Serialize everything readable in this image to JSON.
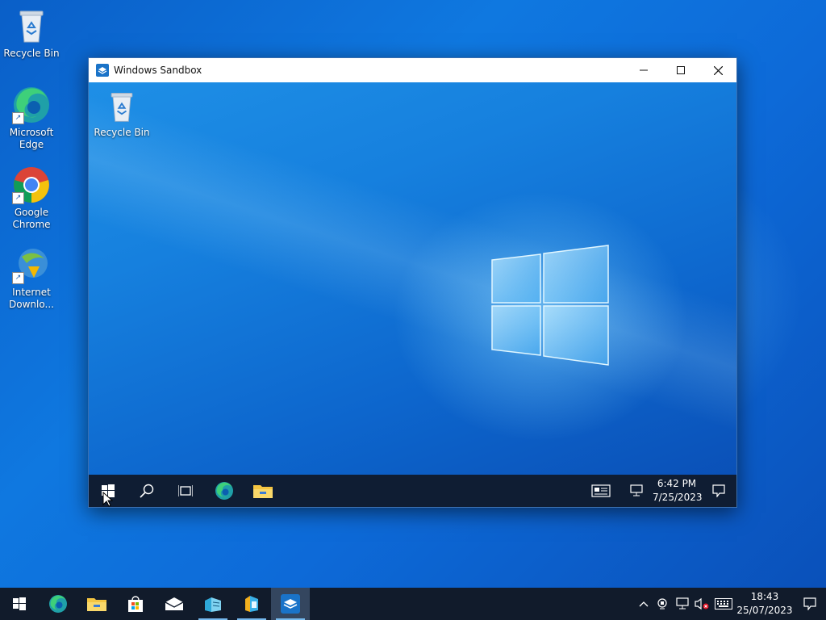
{
  "desktop": {
    "icons": [
      {
        "label": "Recycle Bin",
        "icon": "recycle-bin-icon"
      },
      {
        "label": "Microsoft Edge",
        "icon": "edge-icon"
      },
      {
        "label": "Google Chrome",
        "icon": "chrome-icon"
      },
      {
        "label": "Internet Downlo...",
        "icon": "idm-icon"
      }
    ]
  },
  "sandbox": {
    "title": "Windows Sandbox",
    "desktop_icons": [
      {
        "label": "Recycle Bin",
        "icon": "recycle-bin-icon"
      }
    ],
    "taskbar": {
      "items": [
        "start-icon",
        "search-icon",
        "task-view-icon",
        "edge-icon",
        "file-explorer-icon"
      ],
      "time": "6:42 PM",
      "date": "7/25/2023"
    }
  },
  "taskbar": {
    "items": [
      "start-icon",
      "edge-icon",
      "file-explorer-icon",
      "store-icon",
      "mail-icon",
      "app-icon",
      "app-icon",
      "sandbox-icon"
    ],
    "time": "18:43",
    "date": "25/07/2023"
  },
  "colors": {
    "accent": "#0f78e0",
    "taskbar": "#111b2b"
  }
}
